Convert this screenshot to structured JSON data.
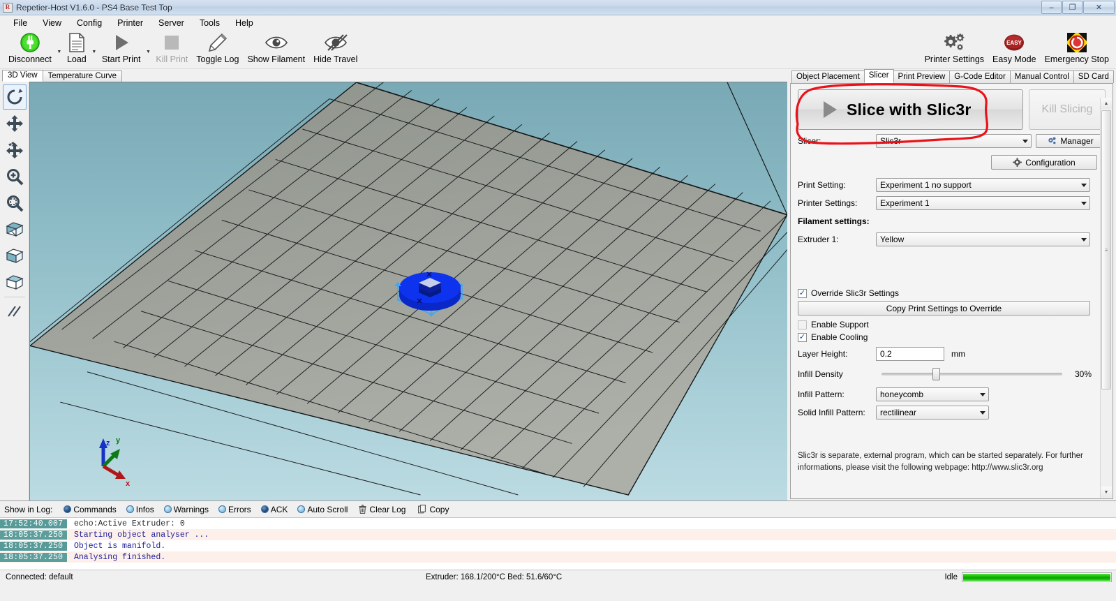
{
  "window": {
    "title": "Repetier-Host V1.6.0 - PS4 Base Test Top",
    "app_icon_letter": "R",
    "minimize": "–",
    "maximize": "❐",
    "close": "✕"
  },
  "menu": {
    "items": [
      "File",
      "View",
      "Config",
      "Printer",
      "Server",
      "Tools",
      "Help"
    ]
  },
  "toolbar": {
    "left_buttons": [
      {
        "label": "Disconnect",
        "icon": "plug-icon",
        "disabled": false,
        "dropdown": true
      },
      {
        "label": "Load",
        "icon": "document-icon",
        "disabled": false,
        "dropdown": true
      },
      {
        "label": "Start Print",
        "icon": "play-icon",
        "disabled": false,
        "dropdown": true
      },
      {
        "label": "Kill Print",
        "icon": "stop-square-icon",
        "disabled": true,
        "dropdown": false
      },
      {
        "label": "Toggle Log",
        "icon": "pencil-icon",
        "disabled": false,
        "dropdown": false
      },
      {
        "label": "Show Filament",
        "icon": "eye-icon",
        "disabled": false,
        "dropdown": false
      },
      {
        "label": "Hide Travel",
        "icon": "eye-slash-icon",
        "disabled": false,
        "dropdown": false
      }
    ],
    "right_buttons": [
      {
        "label": "Printer Settings",
        "icon": "gears-icon"
      },
      {
        "label": "Easy Mode",
        "icon": "easy-badge-icon",
        "badge_text": "EASY"
      },
      {
        "label": "Emergency Stop",
        "icon": "emergency-stop-icon"
      }
    ]
  },
  "view_tabs": {
    "items": [
      "3D View",
      "Temperature Curve"
    ],
    "active": "3D View"
  },
  "side_tools": [
    {
      "name": "rotate-view-tool",
      "icon": "rotate-arrow-icon",
      "selected": true
    },
    {
      "name": "move-object-tool",
      "icon": "four-arrows-icon",
      "selected": false
    },
    {
      "name": "move-view-tool",
      "icon": "four-arrows-hand-icon",
      "selected": false
    },
    {
      "name": "zoom-in-tool",
      "icon": "magnifier-plus-icon",
      "selected": false
    },
    {
      "name": "zoom-fit-tool",
      "icon": "magnifier-fit-icon",
      "selected": false
    },
    {
      "name": "view-mode-split-tool",
      "icon": "cube-split-icon",
      "selected": false
    },
    {
      "name": "view-mode-solid-tool",
      "icon": "cube-solid-icon",
      "selected": false
    },
    {
      "name": "view-mode-wire-tool",
      "icon": "cube-wire-icon",
      "selected": false
    },
    {
      "name": "edges-tool",
      "icon": "slanted-lines-icon",
      "selected": false
    }
  ],
  "viewport": {
    "axis_labels": {
      "x": "x",
      "y": "y",
      "z": "z"
    },
    "background_top": "#79a9b5",
    "background_bottom": "#bcdbe2",
    "bed_color": "#9a9e96",
    "object_color": "#0b30ef",
    "selection_color": "#3ea8f5"
  },
  "panel_tabs": {
    "items": [
      "Object Placement",
      "Slicer",
      "Print Preview",
      "G-Code Editor",
      "Manual Control",
      "SD Card"
    ],
    "active": "Slicer"
  },
  "slicer": {
    "slice_button_label": "Slice with Slic3r",
    "kill_button_label": "Kill Slicing",
    "slicer_label": "Slicer:",
    "slicer_value": "Slic3r",
    "manager_label": "Manager",
    "configuration_label": "Configuration",
    "print_setting_label": "Print Setting:",
    "print_setting_value": "Experiment 1 no support",
    "printer_settings_label": "Printer Settings:",
    "printer_settings_value": "Experiment 1",
    "filament_settings_header": "Filament settings:",
    "extruder1_label": "Extruder 1:",
    "extruder1_value": "Yellow",
    "override_label": "Override Slic3r Settings",
    "override_checked": true,
    "copy_print_settings_label": "Copy Print Settings to Override",
    "enable_support_label": "Enable Support",
    "enable_support_checked": false,
    "enable_cooling_label": "Enable Cooling",
    "enable_cooling_checked": true,
    "layer_height_label": "Layer Height:",
    "layer_height_value": "0.2",
    "layer_height_unit": "mm",
    "infill_density_label": "Infill Density",
    "infill_density_value": "30%",
    "infill_density_percent": 30,
    "infill_pattern_label": "Infill Pattern:",
    "infill_pattern_value": "honeycomb",
    "solid_infill_pattern_label": "Solid Infill Pattern:",
    "solid_infill_pattern_value": "rectilinear",
    "hint_text": "Slic3r is separate, external program, which can be started separately. For further informations, please visit the following webpage: http://www.slic3r.org",
    "annotation_color": "#e8131a"
  },
  "log": {
    "show_in_log_label": "Show in Log:",
    "filters": [
      {
        "label": "Commands",
        "on": true
      },
      {
        "label": "Infos",
        "on": false
      },
      {
        "label": "Warnings",
        "on": false
      },
      {
        "label": "Errors",
        "on": false
      },
      {
        "label": "ACK",
        "on": true
      },
      {
        "label": "Auto Scroll",
        "on": false
      }
    ],
    "actions": [
      {
        "label": "Clear Log",
        "icon": "trash-icon"
      },
      {
        "label": "Copy",
        "icon": "copy-icon"
      }
    ],
    "lines": [
      {
        "time": "17:52:40.007",
        "message": "echo:Active Extruder: 0"
      },
      {
        "time": "18:05:37.250",
        "message": "Starting object analyser ..."
      },
      {
        "time": "18:05:37.250",
        "message": "Object is manifold."
      },
      {
        "time": "18:05:37.250",
        "message": "Analysing finished."
      }
    ]
  },
  "statusbar": {
    "connection": "Connected: default",
    "temperatures": "Extruder: 168.1/200°C Bed: 51.6/60°C",
    "state": "Idle",
    "progress_percent": 100
  }
}
